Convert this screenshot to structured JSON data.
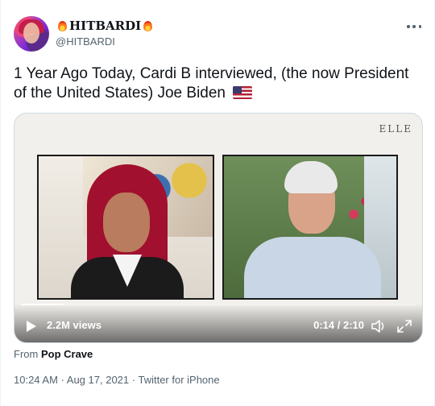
{
  "author": {
    "display_name": "HITBARDI",
    "handle": "@HITBARDI",
    "avatar_icon": "profile-photo",
    "name_emoji": "fire-emoji"
  },
  "tweet": {
    "text": "1 Year Ago Today, Cardi B interviewed, (the now President of the United States) Joe Biden",
    "trailing_emoji": "us-flag-emoji"
  },
  "media": {
    "watermark": "ELLE",
    "views": "2.2M views",
    "time": "0:14 / 2:10",
    "progress": 0.108
  },
  "source": {
    "from_label": "From",
    "from_name": "Pop Crave"
  },
  "meta": {
    "time": "10:24 AM",
    "date": "Aug 17, 2021",
    "client": "Twitter for iPhone",
    "separator": " · "
  },
  "colors": {
    "text": "#0f1419",
    "secondary": "#536471",
    "border": "#cfd9de"
  }
}
